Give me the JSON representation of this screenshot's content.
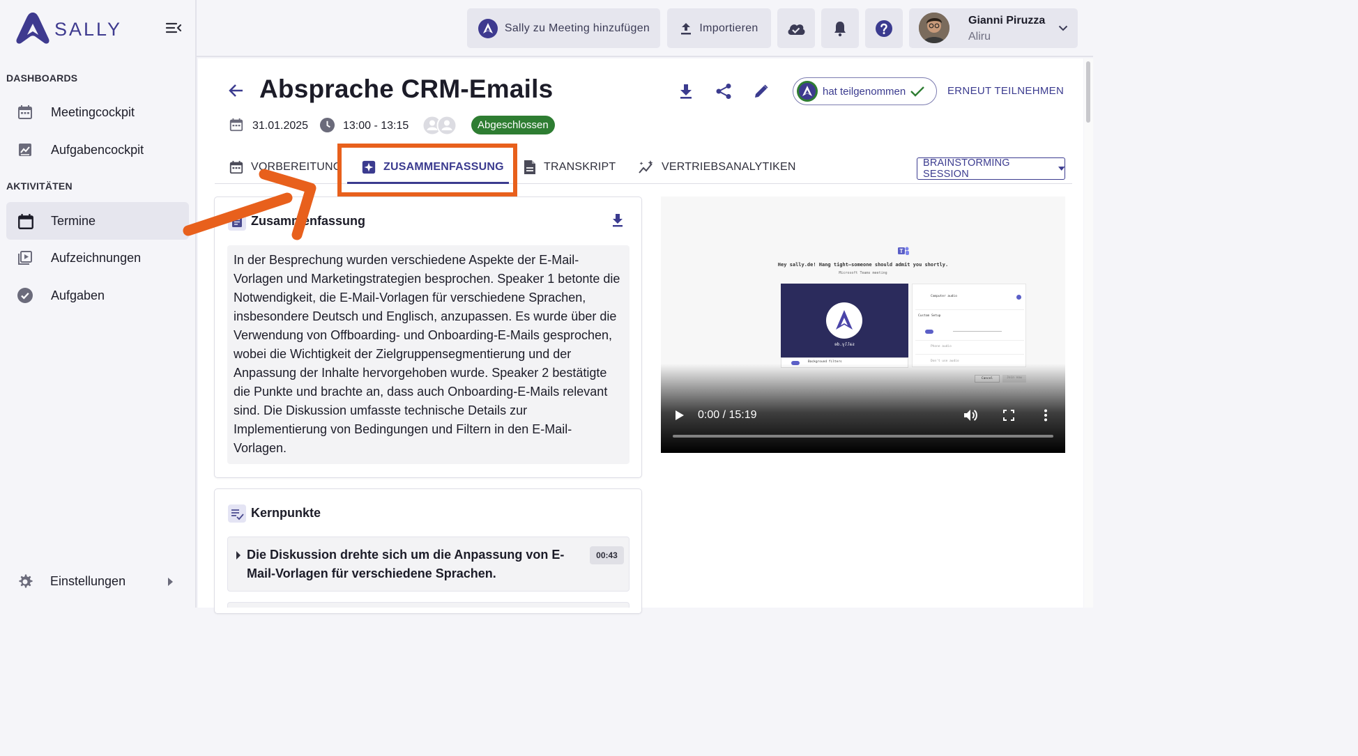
{
  "app": {
    "brand": "SALLY"
  },
  "sidebar": {
    "sections": [
      {
        "label": "DASHBOARDS"
      },
      {
        "label": "AKTIVITÄTEN"
      }
    ],
    "items": [
      {
        "label": "Meetingcockpit",
        "icon": "calendar-icon"
      },
      {
        "label": "Aufgabencockpit",
        "icon": "chart-icon"
      },
      {
        "label": "Termine",
        "icon": "calendar-icon",
        "active": true
      },
      {
        "label": "Aufzeichnungen",
        "icon": "video-library-icon"
      },
      {
        "label": "Aufgaben",
        "icon": "check-circle-icon"
      }
    ],
    "settings_label": "Einstellungen"
  },
  "topbar": {
    "add_to_meeting": "Sally zu Meeting hinzufügen",
    "import": "Importieren",
    "user": {
      "name": "Gianni Piruzza",
      "org": "Aliru"
    }
  },
  "meeting": {
    "title": "Absprache CRM-Emails",
    "date": "31.01.2025",
    "time": "13:00 - 13:15",
    "status": "Abgeschlossen",
    "participation": "hat teilgenommen",
    "rejoin": "ERNEUT TEILNEHMEN"
  },
  "tabs": [
    {
      "label": "VORBEREITUNG"
    },
    {
      "label": "ZUSAMMENFASSUNG",
      "active": true
    },
    {
      "label": "TRANSKRIPT"
    },
    {
      "label": "VERTRIEBSANALYTIKEN"
    }
  ],
  "session_select": {
    "value": "BRAINSTORMING SESSION"
  },
  "summary": {
    "title": "Zusammenfassung",
    "text": "In der Besprechung wurden verschiedene Aspekte der E-Mail-Vorlagen und Marketingstrategien besprochen. Speaker 1 betonte die Notwendigkeit, die E-Mail-Vorlagen für verschiedene Sprachen, insbesondere Deutsch und Englisch, anzupassen. Es wurde über die Verwendung von Offboarding- und Onboarding-E-Mails gesprochen, wobei die Wichtigkeit der Zielgruppensegmentierung und der Anpassung der Inhalte hervorgehoben wurde. Speaker 2 bestätigte die Punkte und brachte an, dass auch Onboarding-E-Mails relevant sind. Die Diskussion umfasste technische Details zur Implementierung von Bedingungen und Filtern in den E-Mail-Vorlagen."
  },
  "keypoints": {
    "title": "Kernpunkte",
    "items": [
      {
        "text": "Die Diskussion drehte sich um die Anpassung von E-Mail-Vorlagen für verschiedene Sprachen.",
        "time": "00:43"
      }
    ]
  },
  "video": {
    "time": "0:00 / 15:19",
    "progress": 0,
    "frame": {
      "heading": "Hey sally.de! Hang tight—someone should admit you shortly.",
      "subheading": "Microsoft Teams meeting",
      "tile_label": "sally.de",
      "background_filters": "Background filters",
      "computer_audio": "Computer audio",
      "custom_setup": "Custom Setup",
      "phone_audio": "Phone audio",
      "dont_use_audio": "Don't use audio",
      "cancel": "Cancel",
      "join_now": "Join now"
    }
  },
  "colors": {
    "brand": "#3b3b8f",
    "status_done": "#2e7d32",
    "annotation": "#e8601c"
  }
}
